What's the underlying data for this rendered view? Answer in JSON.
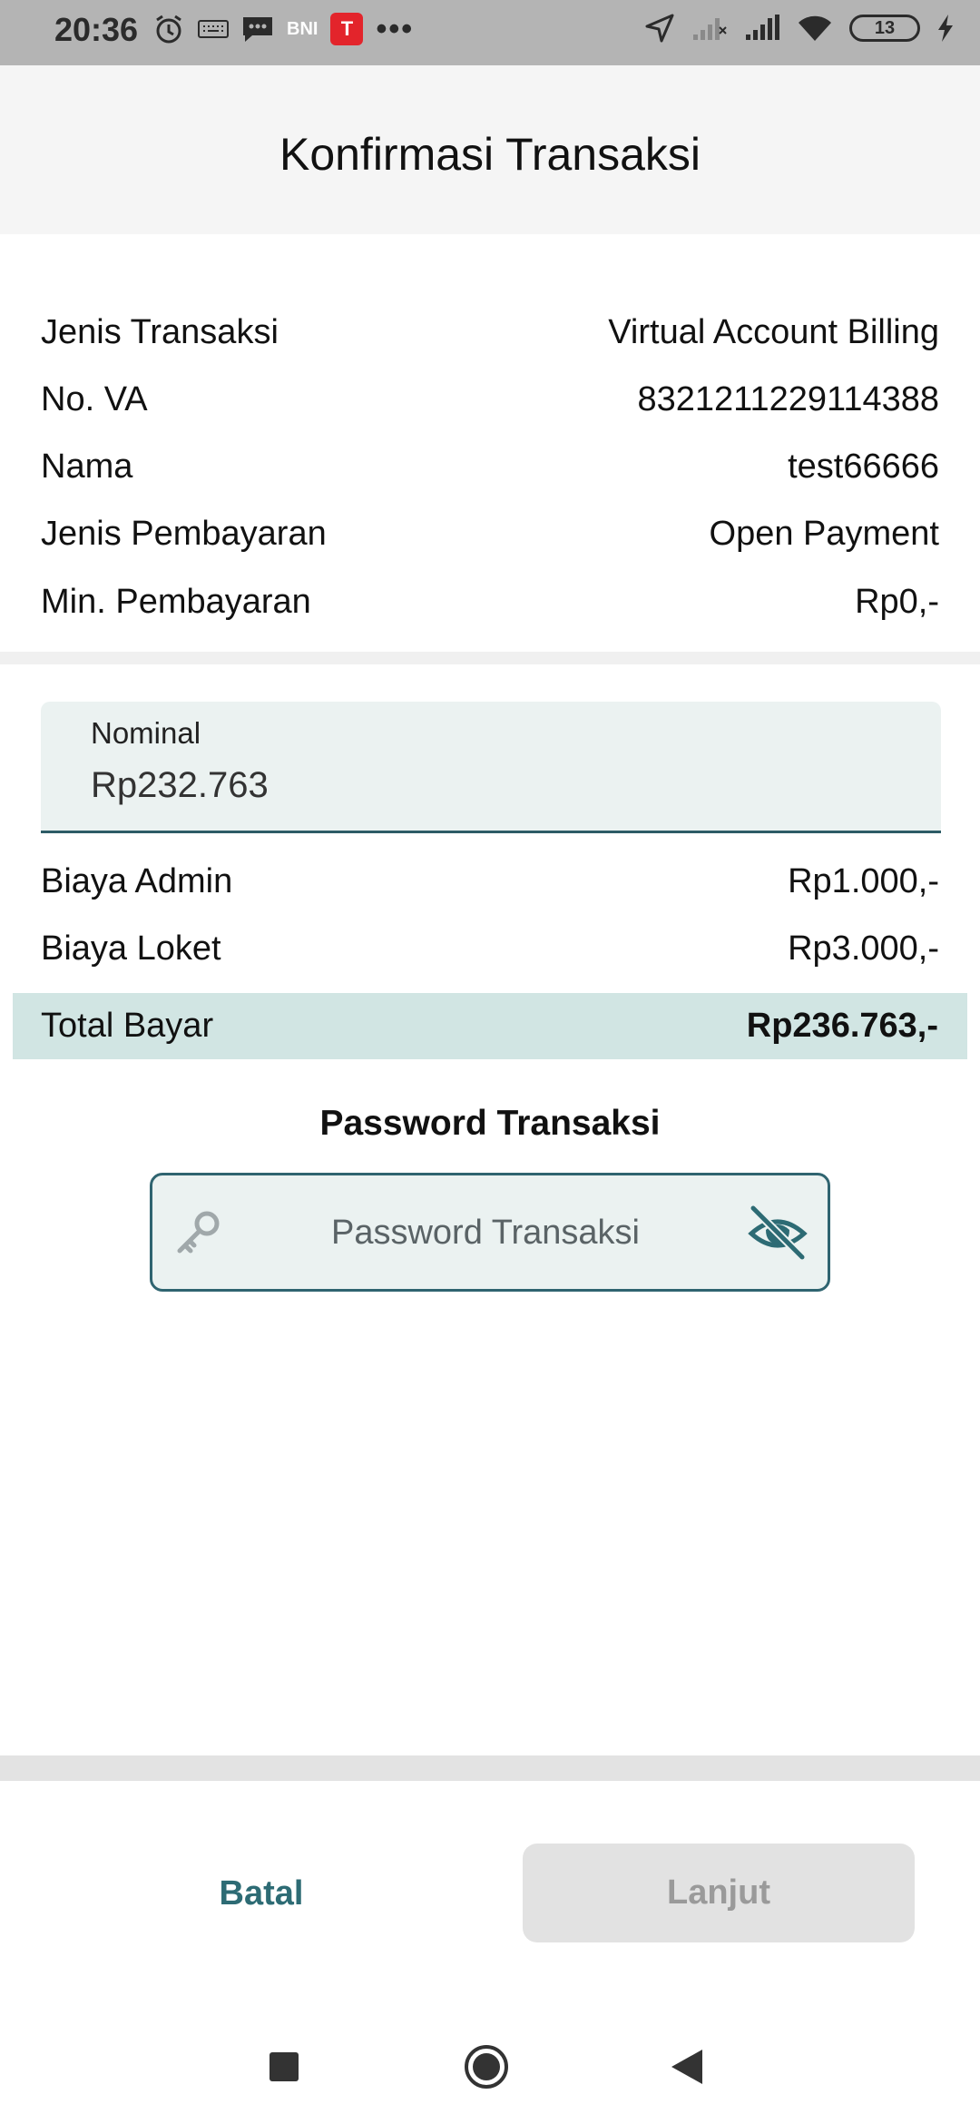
{
  "status_bar": {
    "time": "20:36",
    "bank_badge": "BNI",
    "t_badge": "T",
    "more": "•••",
    "battery_level": "13",
    "icons": [
      "alarm-icon",
      "keyboard-icon",
      "message-icon",
      "bni-icon",
      "t-app-icon",
      "more-icon",
      "location-icon",
      "signal-1-icon",
      "signal-2-icon",
      "wifi-icon",
      "battery-icon",
      "charging-icon"
    ]
  },
  "header": {
    "title": "Konfirmasi Transaksi"
  },
  "details": [
    {
      "label": "Jenis Transaksi",
      "value": "Virtual Account Billing"
    },
    {
      "label": "No. VA",
      "value": "8321211229114388"
    },
    {
      "label": "Nama",
      "value": "test66666"
    },
    {
      "label": "Jenis Pembayaran",
      "value": "Open Payment"
    },
    {
      "label": "Min. Pembayaran",
      "value": "Rp0,-"
    }
  ],
  "nominal": {
    "label": "Nominal",
    "value": "Rp232.763"
  },
  "fees": [
    {
      "label": "Biaya Admin",
      "value": "Rp1.000,-"
    },
    {
      "label": "Biaya Loket",
      "value": "Rp3.000,-"
    }
  ],
  "total": {
    "label": "Total Bayar",
    "value": "Rp236.763,-"
  },
  "password": {
    "title": "Password Transaksi",
    "placeholder": "Password Transaksi"
  },
  "buttons": {
    "cancel": "Batal",
    "next": "Lanjut"
  },
  "colors": {
    "accent": "#2d6b74",
    "field_bg": "#ebf2f1",
    "total_bg": "#d1e5e3",
    "disabled_bg": "#e2e2e2"
  }
}
